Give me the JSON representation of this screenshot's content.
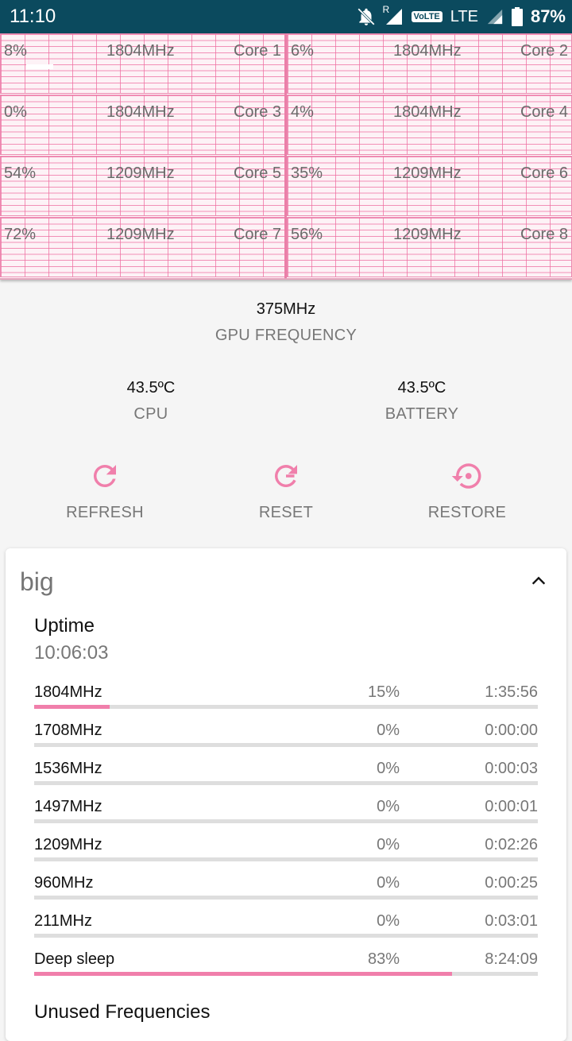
{
  "status_bar": {
    "time": "11:10",
    "roaming": "R",
    "volte": "VoLTE",
    "network": "LTE",
    "battery": "87%"
  },
  "cores": [
    {
      "usage": "8%",
      "freq": "1804MHz",
      "name": "Core 1"
    },
    {
      "usage": "6%",
      "freq": "1804MHz",
      "name": "Core 2"
    },
    {
      "usage": "0%",
      "freq": "1804MHz",
      "name": "Core 3"
    },
    {
      "usage": "4%",
      "freq": "1804MHz",
      "name": "Core 4"
    },
    {
      "usage": "54%",
      "freq": "1209MHz",
      "name": "Core 5"
    },
    {
      "usage": "35%",
      "freq": "1209MHz",
      "name": "Core 6"
    },
    {
      "usage": "72%",
      "freq": "1209MHz",
      "name": "Core 7"
    },
    {
      "usage": "56%",
      "freq": "1209MHz",
      "name": "Core 8"
    }
  ],
  "gpu": {
    "value": "375MHz",
    "label": "GPU FREQUENCY"
  },
  "temps": {
    "cpu": {
      "value": "43.5ºC",
      "label": "CPU"
    },
    "battery": {
      "value": "43.5ºC",
      "label": "BATTERY"
    }
  },
  "actions": {
    "refresh": "REFRESH",
    "reset": "RESET",
    "restore": "RESTORE"
  },
  "accent_color": "#f07fab",
  "card": {
    "title": "big",
    "uptime_label": "Uptime",
    "uptime_value": "10:06:03",
    "rows": [
      {
        "freq": "1804MHz",
        "pct": "15%",
        "time": "1:35:56",
        "fraction": 0.15
      },
      {
        "freq": "1708MHz",
        "pct": "0%",
        "time": "0:00:00",
        "fraction": 0
      },
      {
        "freq": "1536MHz",
        "pct": "0%",
        "time": "0:00:03",
        "fraction": 0
      },
      {
        "freq": "1497MHz",
        "pct": "0%",
        "time": "0:00:01",
        "fraction": 0
      },
      {
        "freq": "1209MHz",
        "pct": "0%",
        "time": "0:02:26",
        "fraction": 0
      },
      {
        "freq": "960MHz",
        "pct": "0%",
        "time": "0:00:25",
        "fraction": 0
      },
      {
        "freq": "211MHz",
        "pct": "0%",
        "time": "0:03:01",
        "fraction": 0
      },
      {
        "freq": "Deep sleep",
        "pct": "83%",
        "time": "8:24:09",
        "fraction": 0.83
      }
    ],
    "unused_label": "Unused Frequencies"
  }
}
